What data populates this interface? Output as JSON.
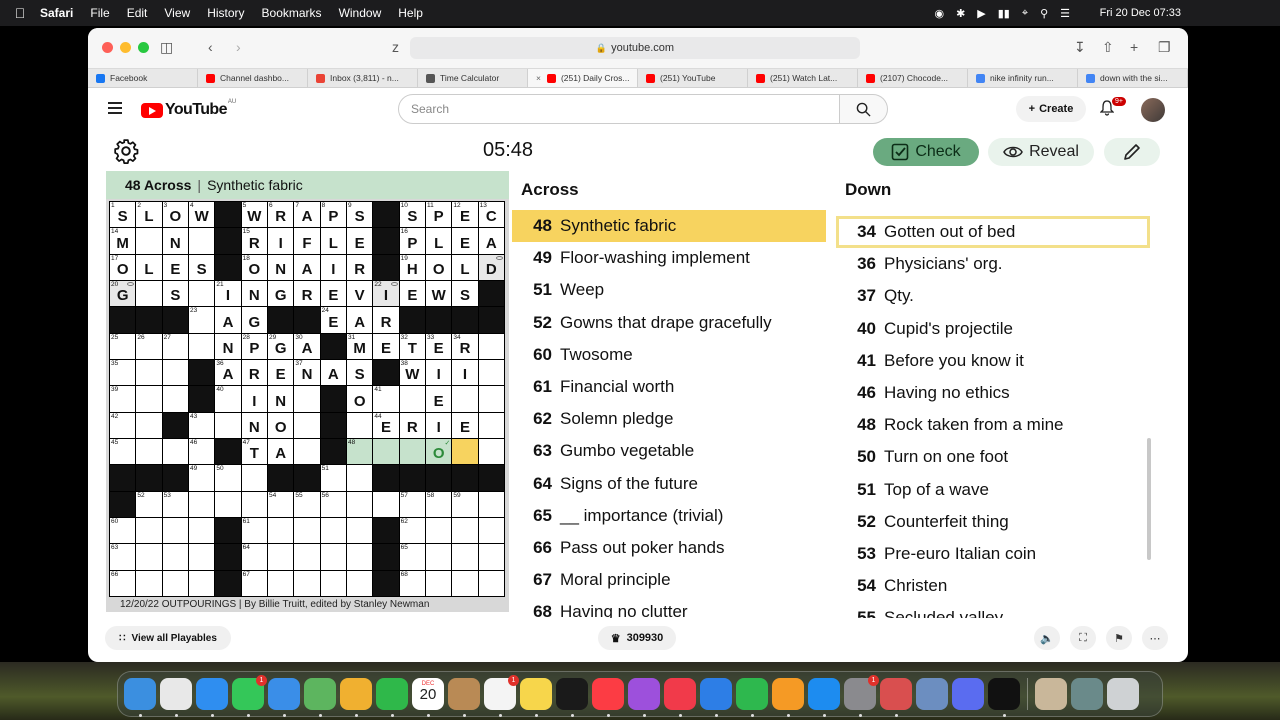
{
  "menubar": {
    "app": "Safari",
    "items": [
      "File",
      "Edit",
      "View",
      "History",
      "Bookmarks",
      "Window",
      "Help"
    ],
    "clock": "Fri 20 Dec  07:33"
  },
  "browser": {
    "address": "youtube.com",
    "tabs": [
      {
        "label": "Facebook",
        "color": "#1877f2"
      },
      {
        "label": "Channel dashbo...",
        "color": "#ff0000"
      },
      {
        "label": "Inbox (3,811) - n...",
        "color": "#ea4335"
      },
      {
        "label": "Time Calculator",
        "color": "#555555"
      },
      {
        "label": "(251) Daily Cros...",
        "color": "#ff0000",
        "active": true
      },
      {
        "label": "(251) YouTube",
        "color": "#ff0000"
      },
      {
        "label": "(251) Watch Lat...",
        "color": "#ff0000"
      },
      {
        "label": "(2107) Chocode...",
        "color": "#ff0000"
      },
      {
        "label": "nike infinity run...",
        "color": "#4285f4"
      },
      {
        "label": "down with the si...",
        "color": "#4285f4"
      }
    ]
  },
  "youtube": {
    "logo": "YouTube",
    "region": "AU",
    "search_placeholder": "Search",
    "create_label": "Create",
    "notif_badge": "9+"
  },
  "game": {
    "timer": "05:48",
    "check_label": "Check",
    "reveal_label": "Reveal",
    "current_clue_number": "48 Across",
    "current_clue_text": "Synthetic fabric",
    "byline": "12/20/22 OUTPOURINGS | By Billie Truitt, edited by Stanley Newman",
    "grid": [
      [
        "1:S",
        "2:L",
        "3:O",
        "4:W",
        "#",
        "5:W",
        "6:R",
        "7:A",
        "8:P",
        "9:S",
        "#",
        "10:S",
        "11:P",
        "12:E",
        "13:C"
      ],
      [
        "14:M",
        "",
        "N",
        "",
        "#",
        "15:R",
        "I",
        "F",
        "L",
        "E",
        "#",
        "16:P",
        "L",
        "E",
        "A"
      ],
      [
        "17:O",
        "L",
        "E",
        "S",
        "#",
        "18:O",
        "N",
        "A",
        "I",
        "R",
        "#",
        "19:H",
        "O",
        "L",
        "D*"
      ],
      [
        "20:G*",
        "",
        "S",
        "",
        "21:I",
        "N",
        "G",
        "R",
        "E",
        "V",
        "22:I*",
        "E",
        "W",
        "S",
        "#"
      ],
      [
        "#",
        "#",
        "#",
        "23:",
        "A",
        "G",
        "#",
        "#",
        "24:E",
        "A",
        "R",
        "#",
        "#",
        "#",
        "#"
      ],
      [
        "25:",
        "26:",
        "27:",
        "",
        "N",
        "28:P",
        "29:G",
        "30:A",
        "#",
        "31:M",
        "E",
        "32:T",
        "33:E",
        "34:R",
        ""
      ],
      [
        "35:",
        "",
        "",
        "#",
        "36:A",
        "R",
        "E",
        "37:N",
        "A",
        "S",
        "#",
        "38:W",
        "I",
        "I",
        ""
      ],
      [
        "39:",
        "",
        "",
        "#",
        "40:",
        "I",
        "N",
        "",
        "#",
        "O",
        "41:",
        "",
        "E",
        "",
        ""
      ],
      [
        "42:",
        "",
        "#",
        "43:",
        "",
        "N",
        "O",
        "",
        "#",
        "",
        "44:E",
        "R",
        "I",
        "E",
        ""
      ],
      [
        "45:",
        "",
        "",
        "46:",
        "#",
        "47:T",
        "A",
        "",
        "#",
        "48:~",
        "~",
        "~",
        "O!",
        "^",
        ""
      ],
      [
        "#",
        "#",
        "#",
        "49:",
        "50:",
        "",
        "#",
        "#",
        "51:",
        "",
        "#",
        "#",
        "#",
        "#",
        "#"
      ],
      [
        "#",
        "52:",
        "53:",
        "",
        "",
        "",
        "54:",
        "55:",
        "56:",
        "",
        "",
        "57:",
        "58:",
        "59:",
        ""
      ],
      [
        "60:",
        "",
        "",
        "",
        "#",
        "61:",
        "",
        "",
        "",
        "",
        "#",
        "62:",
        "",
        "",
        ""
      ],
      [
        "63:",
        "",
        "",
        "",
        "#",
        "64:",
        "",
        "",
        "",
        "",
        "#",
        "65:",
        "",
        "",
        ""
      ],
      [
        "66:",
        "",
        "",
        "",
        "#",
        "67:",
        "",
        "",
        "",
        "",
        "#",
        "68:",
        "",
        "",
        ""
      ]
    ],
    "across_title": "Across",
    "across": [
      {
        "n": "48",
        "text": "Synthetic fabric",
        "selected": true
      },
      {
        "n": "49",
        "text": "Floor-washing implement"
      },
      {
        "n": "51",
        "text": "Weep"
      },
      {
        "n": "52",
        "text": "Gowns that drape gracefully"
      },
      {
        "n": "60",
        "text": "Twosome"
      },
      {
        "n": "61",
        "text": "Financial worth"
      },
      {
        "n": "62",
        "text": "Solemn pledge"
      },
      {
        "n": "63",
        "text": "Gumbo vegetable"
      },
      {
        "n": "64",
        "text": "Signs of the future"
      },
      {
        "n": "65",
        "text": "__ importance (trivial)"
      },
      {
        "n": "66",
        "text": "Pass out poker hands"
      },
      {
        "n": "67",
        "text": "Moral principle"
      },
      {
        "n": "68",
        "text": "Having no clutter"
      }
    ],
    "down_title": "Down",
    "down": [
      {
        "n": "34",
        "text": "Gotten out of bed",
        "selected": true
      },
      {
        "n": "36",
        "text": "Physicians' org."
      },
      {
        "n": "37",
        "text": "Qty."
      },
      {
        "n": "40",
        "text": "Cupid's projectile"
      },
      {
        "n": "41",
        "text": "Before you know it"
      },
      {
        "n": "46",
        "text": "Having no ethics"
      },
      {
        "n": "48",
        "text": "Rock taken from a mine"
      },
      {
        "n": "50",
        "text": "Turn on one foot"
      },
      {
        "n": "51",
        "text": "Top of a wave"
      },
      {
        "n": "52",
        "text": "Counterfeit thing"
      },
      {
        "n": "53",
        "text": "Pre-euro Italian coin"
      },
      {
        "n": "54",
        "text": "Christen"
      },
      {
        "n": "55",
        "text": "Secluded valley"
      }
    ]
  },
  "bottom": {
    "playables_label": "View all Playables",
    "score": "309930"
  },
  "dock": {
    "calendar_month": "DEC",
    "calendar_day": "20",
    "icons": [
      {
        "name": "finder",
        "color": "#3b8fe0"
      },
      {
        "name": "launchpad",
        "color": "#e8e8e8"
      },
      {
        "name": "safari",
        "color": "#2f8ef0"
      },
      {
        "name": "messages",
        "color": "#34c759",
        "badge": "1"
      },
      {
        "name": "mail",
        "color": "#3a8ee8"
      },
      {
        "name": "maps",
        "color": "#5db55f"
      },
      {
        "name": "photos",
        "color": "#f0b030"
      },
      {
        "name": "facetime",
        "color": "#2fb84a"
      },
      {
        "name": "calendar",
        "color": "#ffffff"
      },
      {
        "name": "contacts",
        "color": "#b98a55"
      },
      {
        "name": "reminders",
        "color": "#f4f4f4",
        "badge": "1"
      },
      {
        "name": "notes",
        "color": "#f7d64b"
      },
      {
        "name": "tv",
        "color": "#1a1a1a"
      },
      {
        "name": "music",
        "color": "#fc3c44"
      },
      {
        "name": "podcasts",
        "color": "#9d50dc"
      },
      {
        "name": "news",
        "color": "#f13a4a"
      },
      {
        "name": "keynote",
        "color": "#2d7ee6"
      },
      {
        "name": "numbers",
        "color": "#2eb84e"
      },
      {
        "name": "pages",
        "color": "#f59a25"
      },
      {
        "name": "app-store",
        "color": "#1d8cf0"
      },
      {
        "name": "system-settings",
        "color": "#8a8a8e",
        "badge": "1"
      },
      {
        "name": "iphone-mirroring",
        "color": "#d94f4f"
      },
      {
        "name": "preview",
        "color": "#6c8ec0"
      },
      {
        "name": "messenger",
        "color": "#5a6cf0"
      },
      {
        "name": "capcut",
        "color": "#111111"
      },
      {
        "name": "photo-thumb",
        "color": "#c9b79a"
      },
      {
        "name": "window-thumb",
        "color": "#6a8a8a"
      },
      {
        "name": "trash",
        "color": "#cfd2d4"
      }
    ]
  }
}
